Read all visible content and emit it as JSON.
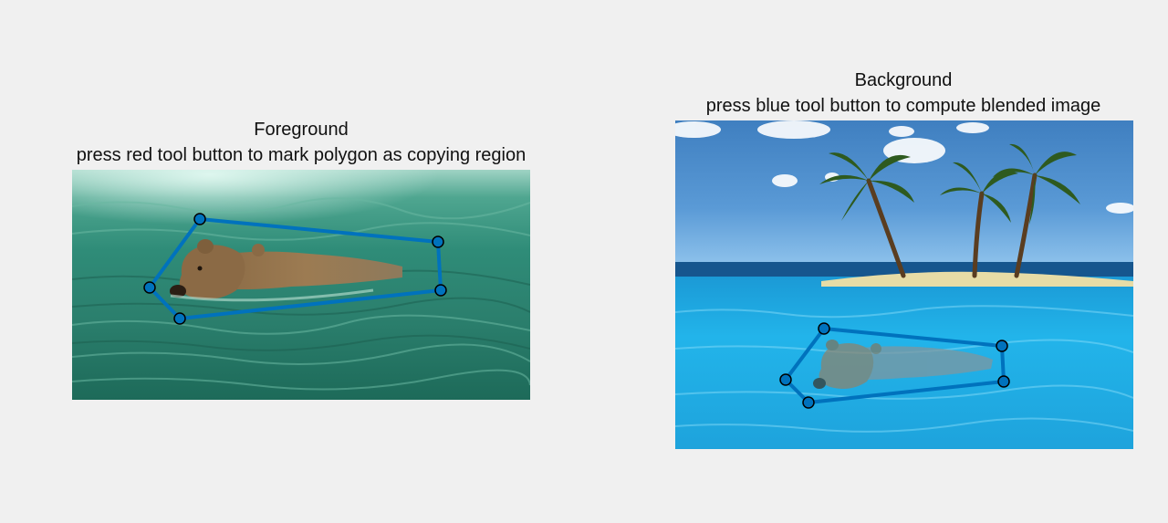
{
  "figure": {
    "foreground": {
      "title": "Foreground",
      "instruction": "press red tool button to mark polygon as copying region"
    },
    "background": {
      "title": "Background",
      "instruction": "press blue tool button to compute blended image"
    }
  },
  "colors": {
    "figure_bg": "#f0f0f0",
    "polygon_line": "#0072bd",
    "vertex_fill": "#0072bd",
    "vertex_edge": "#000000"
  }
}
